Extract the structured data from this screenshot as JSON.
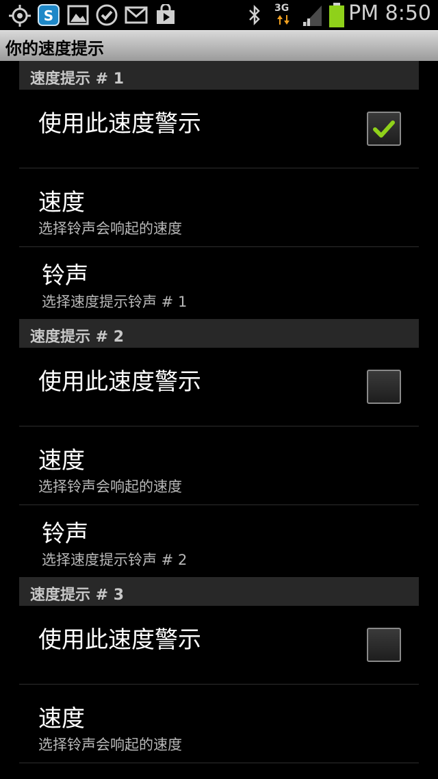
{
  "status_bar": {
    "time": "PM 8:50",
    "network": "3G",
    "icons": [
      "gps-icon",
      "skype-icon",
      "gallery-icon",
      "check-icon",
      "gmail-icon",
      "market-icon",
      "bluetooth-icon",
      "signal-icon",
      "battery-icon"
    ]
  },
  "title": "你的速度提示",
  "groups": [
    {
      "header": "速度提示 # 1",
      "enable_label": "使用此速度警示",
      "enabled": true,
      "speed_title": "速度",
      "speed_summary": "选择铃声会响起的速度",
      "ringtone_title": "铃声",
      "ringtone_summary": "选择速度提示铃声 # 1"
    },
    {
      "header": "速度提示 # 2",
      "enable_label": "使用此速度警示",
      "enabled": false,
      "speed_title": "速度",
      "speed_summary": "选择铃声会响起的速度",
      "ringtone_title": "铃声",
      "ringtone_summary": "选择速度提示铃声 # 2"
    },
    {
      "header": "速度提示 # 3",
      "enable_label": "使用此速度警示",
      "enabled": false,
      "speed_title": "速度",
      "speed_summary": "选择铃声会响起的速度"
    }
  ],
  "colors": {
    "check_mark": "#8fd11a",
    "background": "#000000",
    "battery": "#8fd11a"
  }
}
